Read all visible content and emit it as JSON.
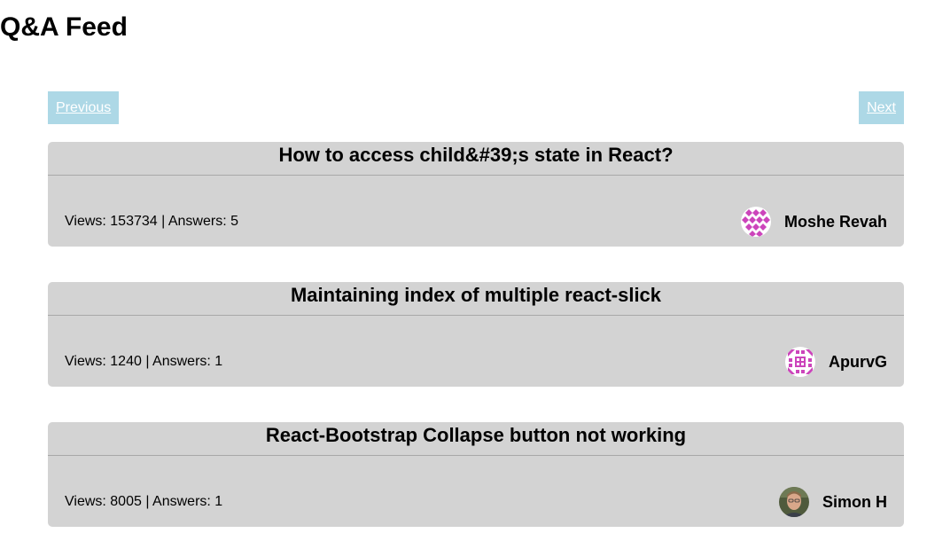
{
  "page": {
    "title": "Q&A Feed"
  },
  "pager": {
    "previous_label": "Previous",
    "next_label": "Next"
  },
  "questions": [
    {
      "title": "How to access child&#39;s state in React?",
      "views": "153734",
      "answers": "5",
      "author": "Moshe Revah",
      "avatar_icon": "identicon-avatar",
      "avatar_color": "#cc44bb"
    },
    {
      "title": "Maintaining index of multiple react-slick",
      "views": "1240",
      "answers": "1",
      "author": "ApurvG",
      "avatar_icon": "identicon-avatar",
      "avatar_color": "#cc44bb"
    },
    {
      "title": "React-Bootstrap Collapse button not working",
      "views": "8005",
      "answers": "1",
      "author": "Simon H",
      "avatar_icon": "photo-avatar",
      "avatar_color": "#6b6a4f"
    }
  ],
  "labels": {
    "views_prefix": "Views: ",
    "separator": " | ",
    "answers_prefix": "Answers: "
  }
}
